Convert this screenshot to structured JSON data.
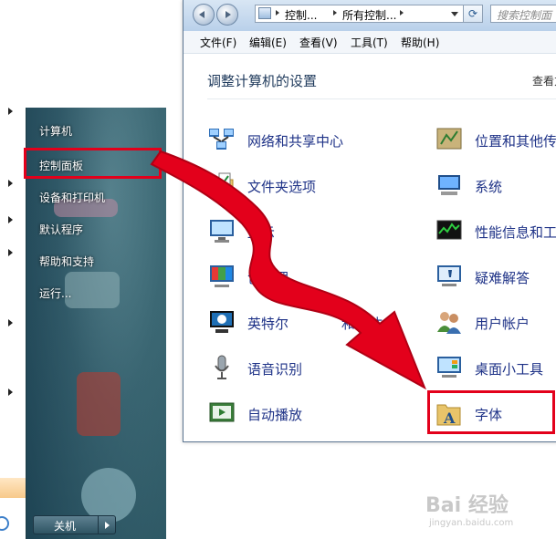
{
  "start_menu": {
    "items": [
      {
        "label": "计算机"
      },
      {
        "label": "控制面板"
      },
      {
        "label": "设备和打印机"
      },
      {
        "label": "默认程序"
      },
      {
        "label": "帮助和支持"
      },
      {
        "label": "运行..."
      }
    ],
    "shutdown_label": "关机"
  },
  "window": {
    "breadcrumb": [
      "控制...",
      "所有控制..."
    ],
    "search_placeholder": "搜索控制面",
    "menu": [
      "文件(F)",
      "编辑(E)",
      "查看(V)",
      "工具(T)",
      "帮助(H)"
    ],
    "content_title": "调整计算机的设置",
    "view_label": "查看方"
  },
  "control_panel_items": {
    "left": [
      {
        "label": "网络和共享中心",
        "icon": "network-sharing-icon"
      },
      {
        "label": "文件夹选项",
        "icon": "folder-options-icon"
      },
      {
        "label": "显示",
        "icon": "display-icon"
      },
      {
        "label": "色管理",
        "icon": "color-management-icon"
      },
      {
        "label": "英特尔",
        "icon": "intel-graphics-icon"
      },
      {
        "label": "语音识别",
        "icon": "microphone-icon"
      },
      {
        "label": "自动播放",
        "icon": "autoplay-icon"
      }
    ],
    "left_extra": {
      "label_tail": "和媒体"
    },
    "right": [
      {
        "label": "位置和其他传",
        "icon": "location-sensor-icon"
      },
      {
        "label": "系统",
        "icon": "system-icon"
      },
      {
        "label": "性能信息和工",
        "icon": "performance-icon"
      },
      {
        "label": "疑难解答",
        "icon": "troubleshooting-icon"
      },
      {
        "label": "用户帐户",
        "icon": "user-accounts-icon"
      },
      {
        "label": "桌面小工具",
        "icon": "desktop-gadgets-icon"
      },
      {
        "label": "字体",
        "icon": "fonts-icon"
      }
    ]
  },
  "watermark": {
    "logo": "Bai 经验",
    "url": "jingyan.baidu.com"
  },
  "colors": {
    "highlight_red": "#e3001b",
    "link_blue": "#1e3287"
  }
}
